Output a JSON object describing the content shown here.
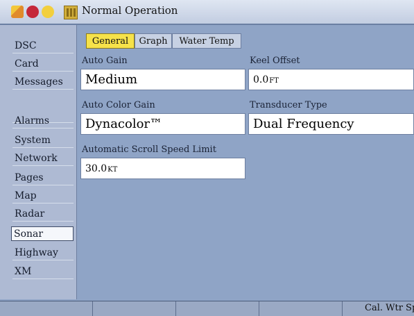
{
  "window": {
    "title": "Normal Operation"
  },
  "system_icons": [
    "page-icon",
    "red-dot-icon",
    "yellow-dot-icon",
    "sonar-icon"
  ],
  "sidebar": {
    "items": [
      {
        "label": "DSC"
      },
      {
        "label": "Card"
      },
      {
        "label": "Messages"
      },
      {
        "label": "Alarms"
      },
      {
        "label": "System"
      },
      {
        "label": "Network"
      },
      {
        "label": "Pages"
      },
      {
        "label": "Map"
      },
      {
        "label": "Radar"
      },
      {
        "label": "Sonar",
        "active": true
      },
      {
        "label": "Highway"
      },
      {
        "label": "XM"
      }
    ]
  },
  "tabs": [
    {
      "label": "General",
      "active": true
    },
    {
      "label": "Graph"
    },
    {
      "label": "Water Temp"
    }
  ],
  "fields": {
    "auto_gain": {
      "label": "Auto Gain",
      "value": "Medium"
    },
    "keel_offset": {
      "label": "Keel Offset",
      "value": "0.0",
      "unit": "FT"
    },
    "auto_color_gain": {
      "label": "Auto Color Gain",
      "value": "Dynacolor™"
    },
    "transducer_type": {
      "label": "Transducer Type",
      "value": "Dual Frequency"
    },
    "scroll_speed_limit": {
      "label": "Automatic Scroll Speed Limit",
      "value": "30.0",
      "unit": "KT"
    }
  },
  "bottom_bar": {
    "right_label": "Cal. Wtr Spd"
  },
  "colors": {
    "active_tab": "#f6e24a",
    "background": "#8fa4c6",
    "sidebar": "#aebad3"
  }
}
